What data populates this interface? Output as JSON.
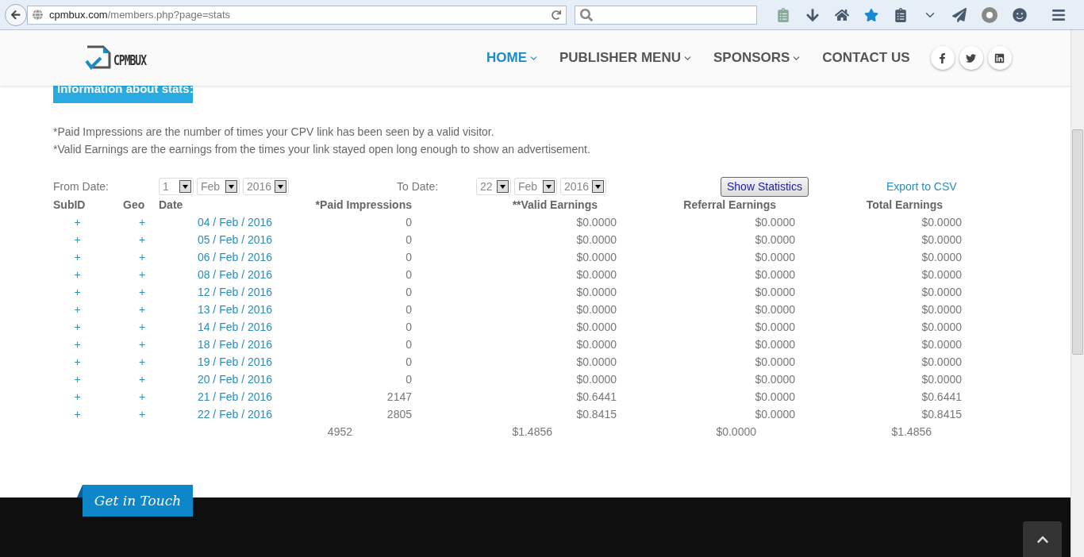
{
  "browser": {
    "url_host": "cpmbux.com",
    "url_path": "/members.php?page=stats"
  },
  "header": {
    "logo_text": "CPMBUX",
    "nav": [
      {
        "label": "HOME",
        "selected": true,
        "dropdown": true
      },
      {
        "label": "PUBLISHER MENU",
        "selected": false,
        "dropdown": true
      },
      {
        "label": "SPONSORS",
        "selected": false,
        "dropdown": true
      },
      {
        "label": "CONTACT US",
        "selected": false,
        "dropdown": false
      }
    ],
    "social": [
      {
        "kind": "facebook"
      },
      {
        "kind": "twitter"
      },
      {
        "kind": "linkedin"
      }
    ]
  },
  "info_banner": "Information about stats:",
  "notes": [
    "*Paid Impressions are the number of times your CPV link has been seen by a valid visitor.",
    "*Valid Earnings are the earnings from the times your link stayed open long enough to show an advertisement."
  ],
  "filter": {
    "from_label": "From Date:",
    "from": [
      "1",
      "Feb",
      "2016"
    ],
    "to_label": "To Date:",
    "to": [
      "22",
      "Feb",
      "2016"
    ],
    "button": "Show Statistics",
    "export": "Export to CSV"
  },
  "table": {
    "columns": [
      "SubID",
      "Geo",
      "Date",
      "*Paid Impressions",
      "**Valid Earnings",
      "Referral Earnings",
      "Total Earnings"
    ],
    "rows": [
      {
        "subid": "+",
        "geo": "+",
        "date": "04 / Feb / 2016",
        "paid": "0",
        "valid": "$0.0000",
        "referral": "$0.0000",
        "total": "$0.0000"
      },
      {
        "subid": "+",
        "geo": "+",
        "date": "05 / Feb / 2016",
        "paid": "0",
        "valid": "$0.0000",
        "referral": "$0.0000",
        "total": "$0.0000"
      },
      {
        "subid": "+",
        "geo": "+",
        "date": "06 / Feb / 2016",
        "paid": "0",
        "valid": "$0.0000",
        "referral": "$0.0000",
        "total": "$0.0000"
      },
      {
        "subid": "+",
        "geo": "+",
        "date": "08 / Feb / 2016",
        "paid": "0",
        "valid": "$0.0000",
        "referral": "$0.0000",
        "total": "$0.0000"
      },
      {
        "subid": "+",
        "geo": "+",
        "date": "12 / Feb / 2016",
        "paid": "0",
        "valid": "$0.0000",
        "referral": "$0.0000",
        "total": "$0.0000"
      },
      {
        "subid": "+",
        "geo": "+",
        "date": "13 / Feb / 2016",
        "paid": "0",
        "valid": "$0.0000",
        "referral": "$0.0000",
        "total": "$0.0000"
      },
      {
        "subid": "+",
        "geo": "+",
        "date": "14 / Feb / 2016",
        "paid": "0",
        "valid": "$0.0000",
        "referral": "$0.0000",
        "total": "$0.0000"
      },
      {
        "subid": "+",
        "geo": "+",
        "date": "18 / Feb / 2016",
        "paid": "0",
        "valid": "$0.0000",
        "referral": "$0.0000",
        "total": "$0.0000"
      },
      {
        "subid": "+",
        "geo": "+",
        "date": "19 / Feb / 2016",
        "paid": "0",
        "valid": "$0.0000",
        "referral": "$0.0000",
        "total": "$0.0000"
      },
      {
        "subid": "+",
        "geo": "+",
        "date": "20 / Feb / 2016",
        "paid": "0",
        "valid": "$0.0000",
        "referral": "$0.0000",
        "total": "$0.0000"
      },
      {
        "subid": "+",
        "geo": "+",
        "date": "21 / Feb / 2016",
        "paid": "2147",
        "valid": "$0.6441",
        "referral": "$0.0000",
        "total": "$0.6441"
      },
      {
        "subid": "+",
        "geo": "+",
        "date": "22 / Feb / 2016",
        "paid": "2805",
        "valid": "$0.8415",
        "referral": "$0.0000",
        "total": "$0.8415"
      }
    ],
    "totals": {
      "paid": "4952",
      "valid": "$1.4856",
      "referral": "$0.0000",
      "total": "$1.4856"
    }
  },
  "footer": {
    "tab": "Get in Touch"
  }
}
